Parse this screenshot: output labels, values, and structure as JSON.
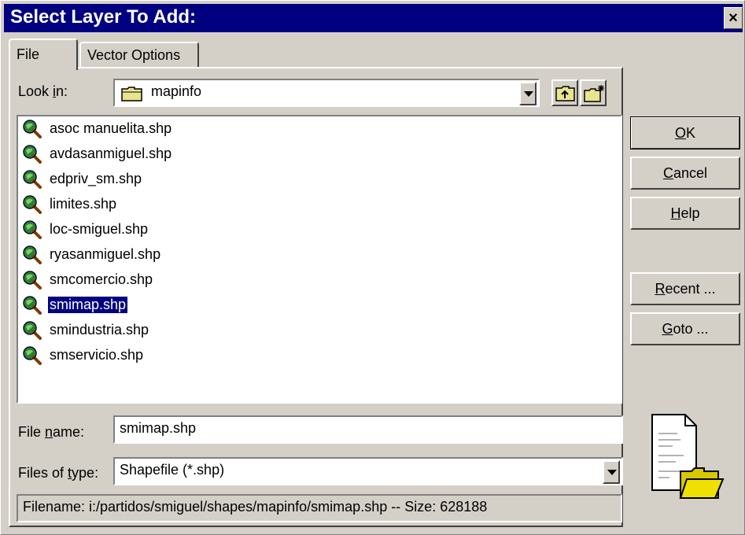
{
  "window": {
    "title": "Select Layer To Add:",
    "close_label": "×"
  },
  "tabs": [
    {
      "label": "File"
    },
    {
      "label": "Vector Options"
    }
  ],
  "look_in": {
    "label_pre": "Look ",
    "label_u": "i",
    "label_post": "n:",
    "value": "mapinfo"
  },
  "files": [
    {
      "name": "asoc manuelita.shp"
    },
    {
      "name": "avdasanmiguel.shp"
    },
    {
      "name": "edpriv_sm.shp"
    },
    {
      "name": "limites.shp"
    },
    {
      "name": "loc-smiguel.shp"
    },
    {
      "name": "ryasanmiguel.shp"
    },
    {
      "name": "smcomercio.shp"
    },
    {
      "name": "smimap.shp",
      "selected": true
    },
    {
      "name": "smindustria.shp"
    },
    {
      "name": "smservicio.shp"
    }
  ],
  "file_name": {
    "label_pre": "File ",
    "label_u": "n",
    "label_post": "ame:",
    "value": "smimap.shp"
  },
  "file_type": {
    "label_pre": "Files of ",
    "label_u": "t",
    "label_post": "ype:",
    "value": "Shapefile (*.shp)"
  },
  "buttons": {
    "ok": {
      "u": "O",
      "rest": "K"
    },
    "cancel": {
      "u": "C",
      "rest": "ancel"
    },
    "help": {
      "u": "H",
      "rest": "elp"
    },
    "recent": {
      "u": "R",
      "rest": "ecent ..."
    },
    "goto": {
      "u": "G",
      "rest": "oto ..."
    }
  },
  "status": "Filename: i:/partidos/smiguel/shapes/mapinfo/smimap.shp -- Size: 628188",
  "colors": {
    "titlebar": "#000080",
    "face": "#d4d0c8",
    "selection": "#000080"
  }
}
